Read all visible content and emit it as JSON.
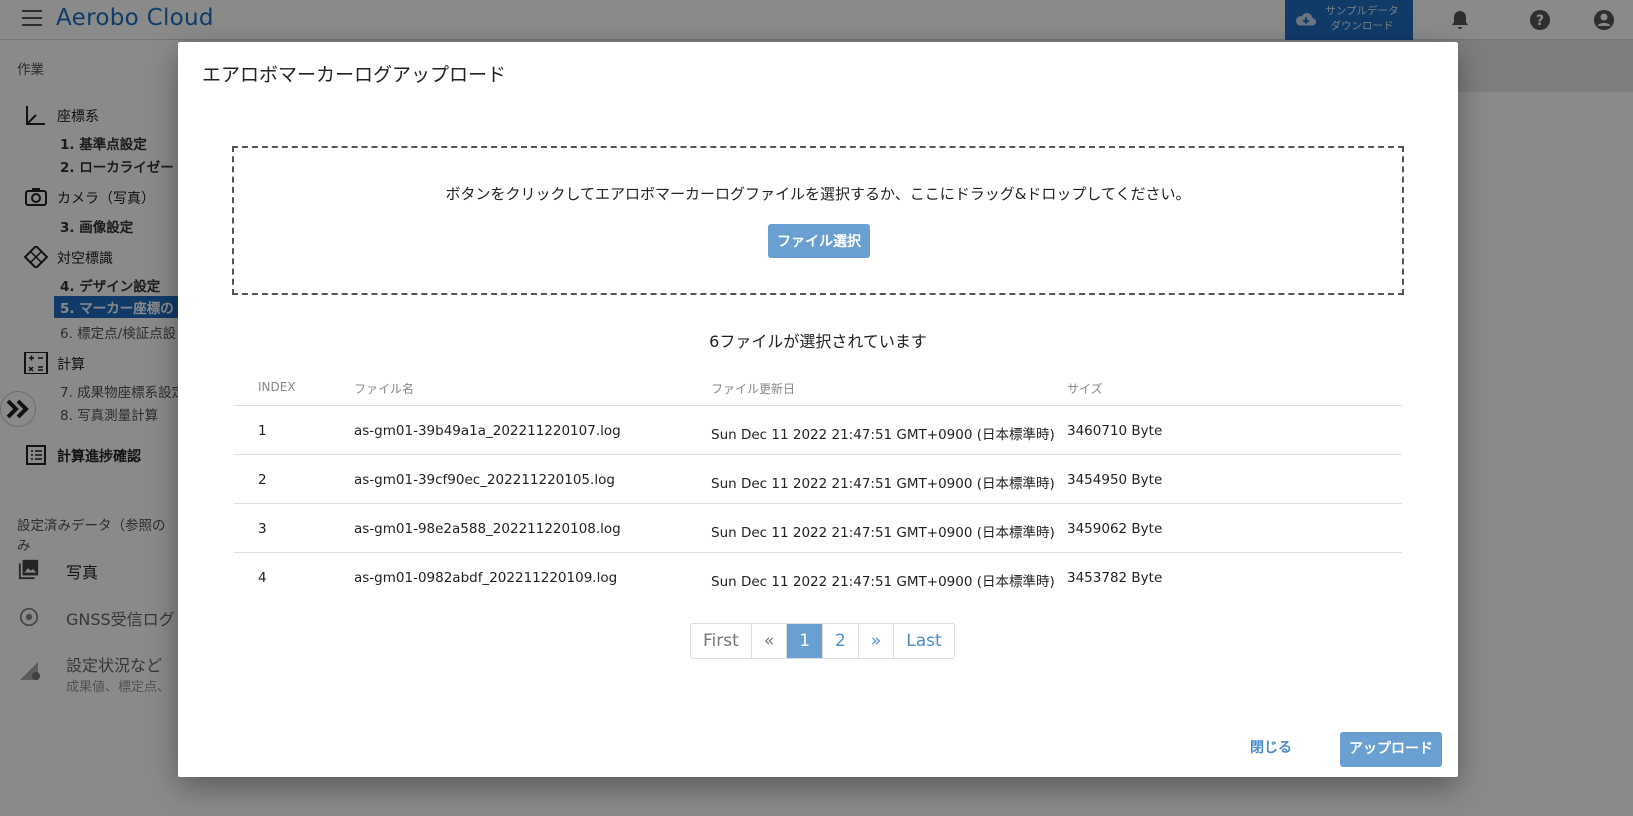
{
  "app": {
    "title": "Aerobo Cloud",
    "sample_button_line1": "サンプルデータ",
    "sample_button_line2": "ダウンロード"
  },
  "sidebar": {
    "section_work": "作業",
    "groups": [
      {
        "label": "座標系",
        "icon": "axis-icon"
      },
      {
        "label": "カメラ（写真）",
        "icon": "camera-icon"
      },
      {
        "label": "対空標識",
        "icon": "diamond-target-icon"
      },
      {
        "label": "計算",
        "icon": "calculator-icon"
      }
    ],
    "items": [
      "1. 基準点設定",
      "2. ローカライゼー",
      "3. 画像設定",
      "4. デザイン設定",
      "5. マーカー座標の",
      "6. 標定点/検証点設",
      "7. 成果物座標系設定",
      "8. 写真測量計算"
    ],
    "progress_label": "計算進捗確認",
    "section_settings": "設定済みデータ（参照のみ",
    "photos": "写真",
    "gnss": "GNSS受信ログ",
    "settings_status": "設定状況など",
    "settings_status_sub": "成果値、標定点、"
  },
  "dialog": {
    "title": "エアロボマーカーログアップロード",
    "drop_message": "ボタンをクリックしてエアロボマーカーログファイルを選択するか、ここにドラッグ&ドロップしてください。",
    "select_button": "ファイル選択",
    "count_text": "6ファイルが選択されています",
    "columns": [
      "INDEX",
      "ファイル名",
      "ファイル更新日",
      "サイズ"
    ],
    "rows": [
      [
        "1",
        "as-gm01-39b49a1a_202211220107.log",
        "Sun Dec 11 2022 21:47:51 GMT+0900 (日本標準時)",
        "3460710 Byte"
      ],
      [
        "2",
        "as-gm01-39cf90ec_202211220105.log",
        "Sun Dec 11 2022 21:47:51 GMT+0900 (日本標準時)",
        "3454950 Byte"
      ],
      [
        "3",
        "as-gm01-98e2a588_202211220108.log",
        "Sun Dec 11 2022 21:47:51 GMT+0900 (日本標準時)",
        "3459062 Byte"
      ],
      [
        "4",
        "as-gm01-0982abdf_202211220109.log",
        "Sun Dec 11 2022 21:47:51 GMT+0900 (日本標準時)",
        "3453782 Byte"
      ]
    ],
    "pagination": {
      "first": "First",
      "prev": "«",
      "pages": [
        "1",
        "2"
      ],
      "current": "1",
      "next": "»",
      "last": "Last"
    },
    "close_button": "閉じる",
    "upload_button": "アップロード"
  },
  "colors": {
    "brand": "#1e6ec2",
    "button": "#6a9fd2",
    "link": "#4a8ccc"
  }
}
